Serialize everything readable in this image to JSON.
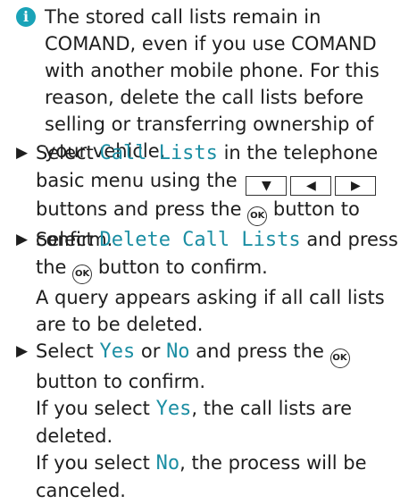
{
  "note": {
    "icon": "info-icon",
    "text": "The stored call lists remain in COMAND, even if you use COMAND with another mobile phone. For this reason, delete the call lists before selling or transferring ownership of your vehicle."
  },
  "steps": [
    {
      "pre": "Select ",
      "term": "Call Lists",
      "mid": " in the telephone basic menu using the ",
      "keys": [
        "▼",
        "◀",
        "▶"
      ],
      "post": " buttons and press the ",
      "ok": "OK",
      "end": " button to confirm."
    },
    {
      "pre": "Select ",
      "term": "Delete Call Lists",
      "mid": " and press the ",
      "ok": "OK",
      "end": " button to confirm.",
      "sub": "A query appears asking if all call lists are to be deleted."
    },
    {
      "pre": "Select ",
      "term_yes": "Yes",
      "or": " or ",
      "term_no": "No",
      "mid": " and press the ",
      "ok": "OK",
      "end": " button to confirm.",
      "sub1_pre": "If you select ",
      "sub1_term": "Yes",
      "sub1_post": ", the call lists are deleted.",
      "sub2_pre": "If you select ",
      "sub2_term": "No",
      "sub2_post": ", the process will be canceled."
    }
  ],
  "bullet": "▶"
}
